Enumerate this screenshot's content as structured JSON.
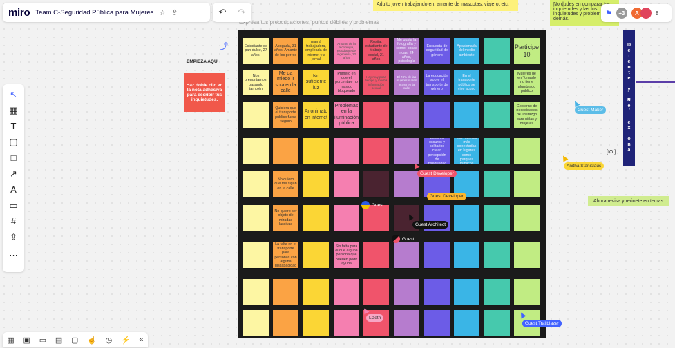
{
  "app": {
    "logo": "miro",
    "board_title": "Team C-Seguridad Pública para Mujeres",
    "board_header": "Expresa tus preocupaciones, puntos débiles y problemas"
  },
  "topbar": {
    "star_icon": "star-icon",
    "share_icon": "upload-icon"
  },
  "right_bar": {
    "count": "+3",
    "avatars_count": "8"
  },
  "top_notes": {
    "left": "Adulto joven trabajando en, amante de mascotas, viajero, etc.",
    "right": "No dudes en comparar tus inquietudes y las tus inquietudes y problem las demás."
  },
  "canvas": {
    "empieza": "EMPIEZA AQUÍ",
    "red_note": "Haz doble clic en la nota adhesiva para escribir tus inquietudes.",
    "banner": "Detente y Reflexiona",
    "ahora": "Ahora revisa y reúnete en temas",
    "ioi": "[IOI]"
  },
  "cursors": {
    "guest_maker": "Guest Maker",
    "anitha": "Anitha Stanislaus",
    "guest_developer_1": "Guest Developer",
    "guest_developer_2": "Guest Developer",
    "guest_architect": "Guest Architect",
    "guest_1": "Guest",
    "guest_2": "Guest",
    "lizeth": "Lizeth",
    "guest_trailblazer": "Guest Trailblazer"
  },
  "colors": {
    "col": [
      "#fdf6a3",
      "#fba344",
      "#fbd635",
      "#f57fb0",
      "#f0546b",
      "#b67cce",
      "#6c5ce7",
      "#3ab5e6",
      "#46c9ad",
      "#c1ec83"
    ]
  },
  "notes": [
    [
      {
        "t": "Estudiante de pan dulce, 27 años.",
        "s": ""
      },
      {
        "t": "Abogada, 31 años. Amante de los perros",
        "s": ""
      },
      {
        "t": "mamá trabajadora, empleada de internet y a jornal",
        "s": ""
      },
      {
        "t": "Amante de la tecnología, estudiante de ingeniería, 22 años",
        "s": "faint"
      },
      {
        "t": "Rosita, estudiante de trabajo social, 21 años",
        "s": ""
      },
      {
        "t": "Me gusta la fotografía y comer cosas ricas, 24 años, psicología",
        "s": ""
      },
      {
        "t": "Encuesta de seguridad de género",
        "s": ""
      },
      {
        "t": "Apasionada del medio ambiente",
        "s": ""
      },
      {
        "t": "",
        "s": "faint"
      },
      {
        "t": "Participe 10",
        "s": "bigger"
      }
    ],
    [
      {
        "t": "Nos preguntamos, pasando también",
        "s": ""
      },
      {
        "t": "Me da miedo ir sola en la calle",
        "s": "big"
      },
      {
        "t": "No suficiente luz",
        "s": "big"
      },
      {
        "t": "Primero en que el porcentaje no ha sido bloqueado",
        "s": ""
      },
      {
        "t": "Hay muy poca tiempo y mucha información sexual",
        "s": "faint"
      },
      {
        "t": "El 74% de las mujeres sufren acoso en la calle",
        "s": "faint"
      },
      {
        "t": "La educación sobre el transporte de género",
        "s": ""
      },
      {
        "t": "En el transporte público se vive acoso",
        "s": ""
      },
      {
        "t": "",
        "s": "faint"
      },
      {
        "t": "Mujeres de en Tomarlo no tiene alumbrado público",
        "s": ""
      }
    ],
    [
      {
        "t": "",
        "s": ""
      },
      {
        "t": "Quisiera que el transporte público fuera seguro",
        "s": ""
      },
      {
        "t": "Anonimato en internet",
        "s": "big"
      },
      {
        "t": "Problemas en la iluminación pública",
        "s": "big"
      },
      {
        "t": "",
        "s": ""
      },
      {
        "t": "",
        "s": "faint"
      },
      {
        "t": "",
        "s": "faint"
      },
      {
        "t": "",
        "s": "faint"
      },
      {
        "t": "",
        "s": ""
      },
      {
        "t": "Gobierno de necesidades de liderazgo para niñas y mujeres",
        "s": ""
      }
    ],
    [
      {
        "t": "",
        "s": ""
      },
      {
        "t": "",
        "s": "faint"
      },
      {
        "t": "",
        "s": "faint"
      },
      {
        "t": "",
        "s": "faint"
      },
      {
        "t": "",
        "s": ""
      },
      {
        "t": "",
        "s": "faint"
      },
      {
        "t": "Lugares oscuros y solitarios crean percepción de inseguridad",
        "s": ""
      },
      {
        "t": "Las mujeres más conectadas en lugares como parques públicos",
        "s": ""
      },
      {
        "t": "",
        "s": ""
      },
      {
        "t": "",
        "s": ""
      }
    ],
    [
      {
        "t": "",
        "s": ""
      },
      {
        "t": "No quiero que me sigan en la calle",
        "s": ""
      },
      {
        "t": "",
        "s": ""
      },
      {
        "t": "",
        "s": "faint"
      },
      {
        "t": "",
        "s": "dark"
      },
      {
        "t": "",
        "s": "faint"
      },
      {
        "t": "",
        "s": "faint"
      },
      {
        "t": "",
        "s": "faint"
      },
      {
        "t": "",
        "s": ""
      },
      {
        "t": "",
        "s": ""
      }
    ],
    [
      {
        "t": "",
        "s": ""
      },
      {
        "t": "No quiero ser objeto de miradas lascivas",
        "s": ""
      },
      {
        "t": "",
        "s": ""
      },
      {
        "t": "",
        "s": "faint"
      },
      {
        "t": "",
        "s": ""
      },
      {
        "t": "",
        "s": "dark"
      },
      {
        "t": "",
        "s": "faint"
      },
      {
        "t": "",
        "s": "faint"
      },
      {
        "t": "",
        "s": ""
      },
      {
        "t": "",
        "s": ""
      }
    ],
    [
      {
        "t": "",
        "s": ""
      },
      {
        "t": "La falta en el transporte para personas con alguna discapacidad",
        "s": ""
      },
      {
        "t": "",
        "s": ""
      },
      {
        "t": "Sin falta para el que alguna persona que pueden pedir ayuda",
        "s": ""
      },
      {
        "t": "",
        "s": ""
      },
      {
        "t": "",
        "s": ""
      },
      {
        "t": "",
        "s": "faint"
      },
      {
        "t": "",
        "s": "faint"
      },
      {
        "t": "",
        "s": ""
      },
      {
        "t": "",
        "s": ""
      }
    ],
    [
      {
        "t": "",
        "s": ""
      },
      {
        "t": "",
        "s": ""
      },
      {
        "t": "",
        "s": ""
      },
      {
        "t": "",
        "s": ""
      },
      {
        "t": "",
        "s": ""
      },
      {
        "t": "",
        "s": ""
      },
      {
        "t": "",
        "s": ""
      },
      {
        "t": "",
        "s": ""
      },
      {
        "t": "",
        "s": ""
      },
      {
        "t": "",
        "s": ""
      }
    ],
    [
      {
        "t": "",
        "s": ""
      },
      {
        "t": "",
        "s": ""
      },
      {
        "t": "",
        "s": ""
      },
      {
        "t": "",
        "s": ""
      },
      {
        "t": "",
        "s": ""
      },
      {
        "t": "",
        "s": ""
      },
      {
        "t": "",
        "s": ""
      },
      {
        "t": "",
        "s": ""
      },
      {
        "t": "",
        "s": ""
      },
      {
        "t": "",
        "s": ""
      }
    ]
  ],
  "left_tools": [
    {
      "icon": "cursor-icon",
      "g": "↖",
      "active": true
    },
    {
      "icon": "template-icon",
      "g": "▦"
    },
    {
      "icon": "text-icon",
      "g": "T"
    },
    {
      "icon": "sticky-note-icon",
      "g": "▢"
    },
    {
      "icon": "shape-icon",
      "g": "□"
    },
    {
      "icon": "line-icon",
      "g": "↗"
    },
    {
      "icon": "pen-icon",
      "g": "A"
    },
    {
      "icon": "comment-icon",
      "g": "▭"
    },
    {
      "icon": "frame-icon",
      "g": "#"
    },
    {
      "icon": "upload-icon",
      "g": "⇪"
    },
    {
      "icon": "more-icon",
      "g": "…"
    }
  ],
  "bottom_tools": [
    {
      "icon": "grid-icon",
      "g": "▦"
    },
    {
      "icon": "frame-icon",
      "g": "▣"
    },
    {
      "icon": "comment-icon",
      "g": "▭"
    },
    {
      "icon": "cards-icon",
      "g": "▤"
    },
    {
      "icon": "screen-icon",
      "g": "▢"
    },
    {
      "icon": "like-icon",
      "g": "☝"
    },
    {
      "icon": "timer-icon",
      "g": "◷"
    },
    {
      "icon": "lightning-icon",
      "g": "⚡"
    },
    {
      "icon": "collapse-icon",
      "g": "«"
    }
  ]
}
